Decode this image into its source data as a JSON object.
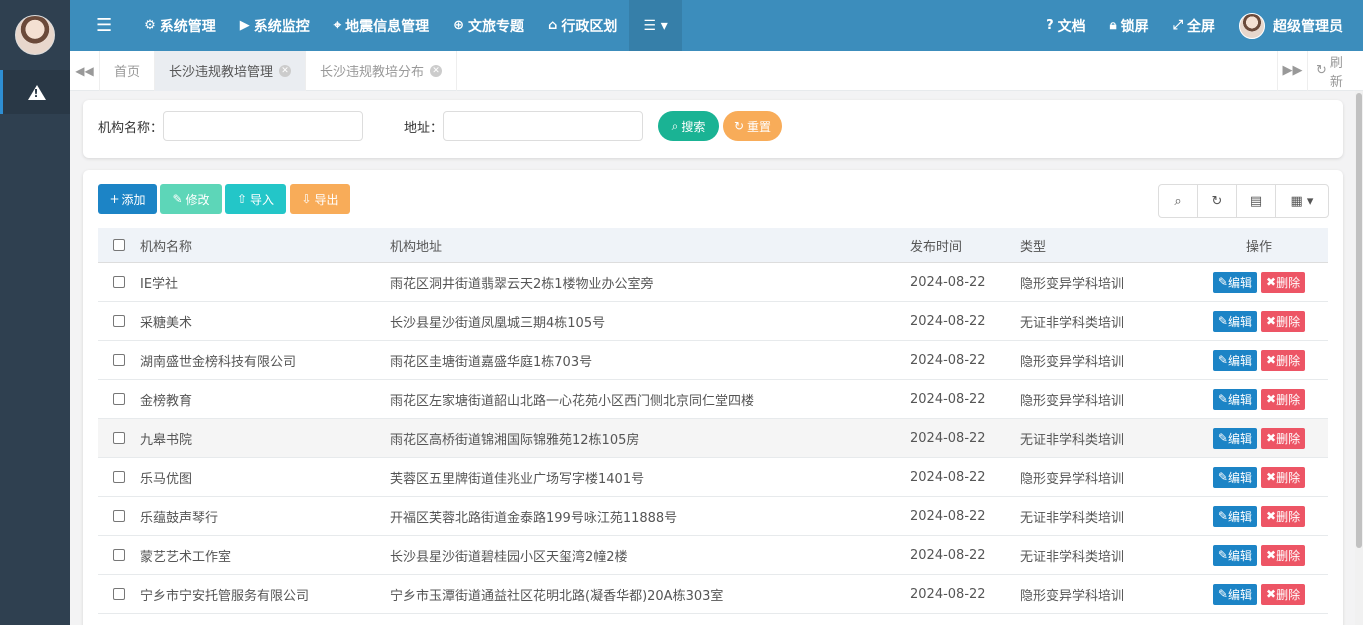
{
  "topnav": {
    "items": [
      {
        "icon": "gear-icon",
        "glyph": "⚙",
        "label": "系统管理"
      },
      {
        "icon": "video-icon",
        "glyph": "▶",
        "label": "系统监控"
      },
      {
        "icon": "map-marker-icon",
        "glyph": "⌖",
        "label": "地震信息管理"
      },
      {
        "icon": "globe-icon",
        "glyph": "⊕",
        "label": "文旅专题"
      },
      {
        "icon": "bank-icon",
        "glyph": "⌂",
        "label": "行政区划"
      }
    ],
    "more_glyph": "☰ ▾",
    "right": {
      "docs": "文档",
      "lock": "锁屏",
      "fullscreen": "全屏",
      "user": "超级管理员"
    }
  },
  "tabs": {
    "home": "首页",
    "items": [
      {
        "label": "长沙违规教培管理",
        "active": true
      },
      {
        "label": "长沙违规教培分布",
        "active": false
      }
    ],
    "refresh": "刷新"
  },
  "search": {
    "name_label": "机构名称：",
    "addr_label": "地址：",
    "name_value": "",
    "addr_value": "",
    "search_btn": "搜索",
    "reset_btn": "重置"
  },
  "toolbar": {
    "add": "添加",
    "edit": "修改",
    "import": "导入",
    "export": "导出"
  },
  "table": {
    "headers": [
      "机构名称",
      "机构地址",
      "发布时间",
      "类型",
      "操作"
    ],
    "rows": [
      {
        "name": "IE学社",
        "addr": "雨花区洞井街道翡翠云天2栋1楼物业办公室旁",
        "time": "2024-08-22",
        "type": "隐形变异学科培训"
      },
      {
        "name": "采糖美术",
        "addr": "长沙县星沙街道凤凰城三期4栋105号",
        "time": "2024-08-22",
        "type": "无证非学科类培训"
      },
      {
        "name": "湖南盛世金榜科技有限公司",
        "addr": "雨花区圭塘街道嘉盛华庭1栋703号",
        "time": "2024-08-22",
        "type": "隐形变异学科培训"
      },
      {
        "name": "金榜教育",
        "addr": "雨花区左家塘街道韶山北路一心花苑小区西门侧北京同仁堂四楼",
        "time": "2024-08-22",
        "type": "隐形变异学科培训"
      },
      {
        "name": "九皋书院",
        "addr": "雨花区高桥街道锦湘国际锦雅苑12栋105房",
        "time": "2024-08-22",
        "type": "无证非学科类培训"
      },
      {
        "name": "乐马优图",
        "addr": "芙蓉区五里牌街道佳兆业广场写字楼1401号",
        "time": "2024-08-22",
        "type": "隐形变异学科培训"
      },
      {
        "name": "乐蕴鼓声琴行",
        "addr": "开福区芙蓉北路街道金泰路199号咏江苑11888号",
        "time": "2024-08-22",
        "type": "无证非学科类培训"
      },
      {
        "name": "蒙艺艺术工作室",
        "addr": "长沙县星沙街道碧桂园小区天玺湾2幢2楼",
        "time": "2024-08-22",
        "type": "无证非学科类培训"
      },
      {
        "name": "宁乡市宁安托管服务有限公司",
        "addr": "宁乡市玉潭街道通益社区花明北路(凝香华都)20A栋303室",
        "time": "2024-08-22",
        "type": "隐形变异学科培训"
      }
    ],
    "edit_label": "编辑",
    "delete_label": "删除"
  },
  "colors": {
    "topnav": "#3c8dbc",
    "sidebar": "#2f4050",
    "search_btn": "#1ab394",
    "reset_btn": "#f8ac59",
    "add_btn": "#1c84c6",
    "edit_btn": "#5dd6b8",
    "import_btn": "#23c6c8",
    "export_btn": "#f8ac59",
    "row_edit": "#1c84c6",
    "row_delete": "#ed5565"
  }
}
